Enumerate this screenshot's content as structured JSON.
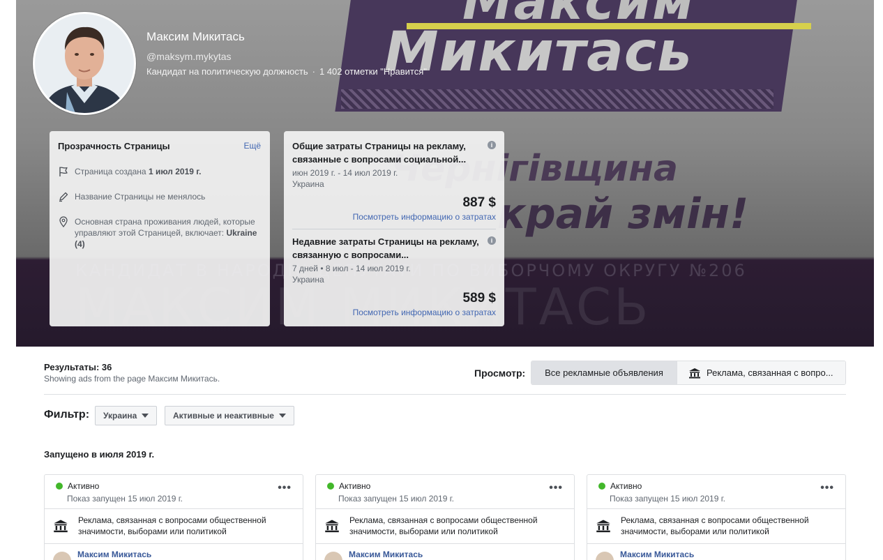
{
  "profile": {
    "name": "Максим Микитась",
    "handle": "@maksym.mykytas",
    "category": "Кандидат на политическую должность",
    "likes": "1 402 отметки \"Нравится\""
  },
  "cover": {
    "banner_line1": "Максим",
    "banner_line2": "Микитась",
    "slogan_line1": "Чернігівщина",
    "slogan_line2": "край змін!",
    "subtitle": "КАНДИДАТ В НАРОДНІ ДЕПУТАТИ ПО ВИБОРЧОМУ ОКРУГУ №206",
    "big_name": "МАКСИМ МИКИТАСЬ"
  },
  "transparency": {
    "title": "Прозрачность Страницы",
    "more": "Ещё",
    "created_prefix": "Страница создана ",
    "created_date": "1 июл 2019 г.",
    "name_unchanged": "Название Страницы не менялось",
    "country_text": "Основная страна проживания людей, которые управляют этой Страницей, включает: ",
    "country_value": "Ukraine (4)"
  },
  "spend": {
    "total": {
      "title": "Общие затраты Страницы на рекламу, связанные с вопросами социальной...",
      "dates": "июн 2019 г. - 14 июл 2019 г.",
      "country": "Украина",
      "amount": "887 $",
      "link": "Посмотреть информацию о затратах"
    },
    "recent": {
      "title": "Недавние затраты Страницы на рекламу, связанную с вопросами...",
      "dates": "7 дней • 8 июл - 14 июл 2019 г.",
      "country": "Украина",
      "amount": "589 $",
      "link": "Посмотреть информацию о затратах"
    }
  },
  "results": {
    "count": "Результаты: 36",
    "sub": "Showing ads from the page Максим Микитась.",
    "view_label": "Просмотр:",
    "view_all": "Все рекламные объявления",
    "view_political": "Реклама, связанная с вопро..."
  },
  "filter": {
    "label": "Фильтр:",
    "country": "Украина",
    "status": "Активные и неактивные"
  },
  "launched_heading": "Запущено в июля 2019 г.",
  "ads": [
    {
      "status": "Активно",
      "started": "Показ запущен 15 июл 2019 г.",
      "category": "Реклама, связанная с вопросами общественной значимости, выборами или политикой",
      "page": "Максим Микитась"
    },
    {
      "status": "Активно",
      "started": "Показ запущен 15 июл 2019 г.",
      "category": "Реклама, связанная с вопросами общественной значимости, выборами или политикой",
      "page": "Максим Микитась"
    },
    {
      "status": "Активно",
      "started": "Показ запущен 15 июл 2019 г.",
      "category": "Реклама, связанная с вопросами общественной значимости, выборами или политикой",
      "page": "Максим Микитась"
    }
  ],
  "ad_menu_glyph": "•••",
  "icons": [
    "flag-icon",
    "pencil-icon",
    "location-pin-icon",
    "info-icon",
    "institution-icon",
    "caret-down-icon"
  ],
  "colors": {
    "link": "#4267b2",
    "active_dot": "#42b72a",
    "cover_purple": "#47375a",
    "stripe_yellow": "#d6d04c"
  }
}
